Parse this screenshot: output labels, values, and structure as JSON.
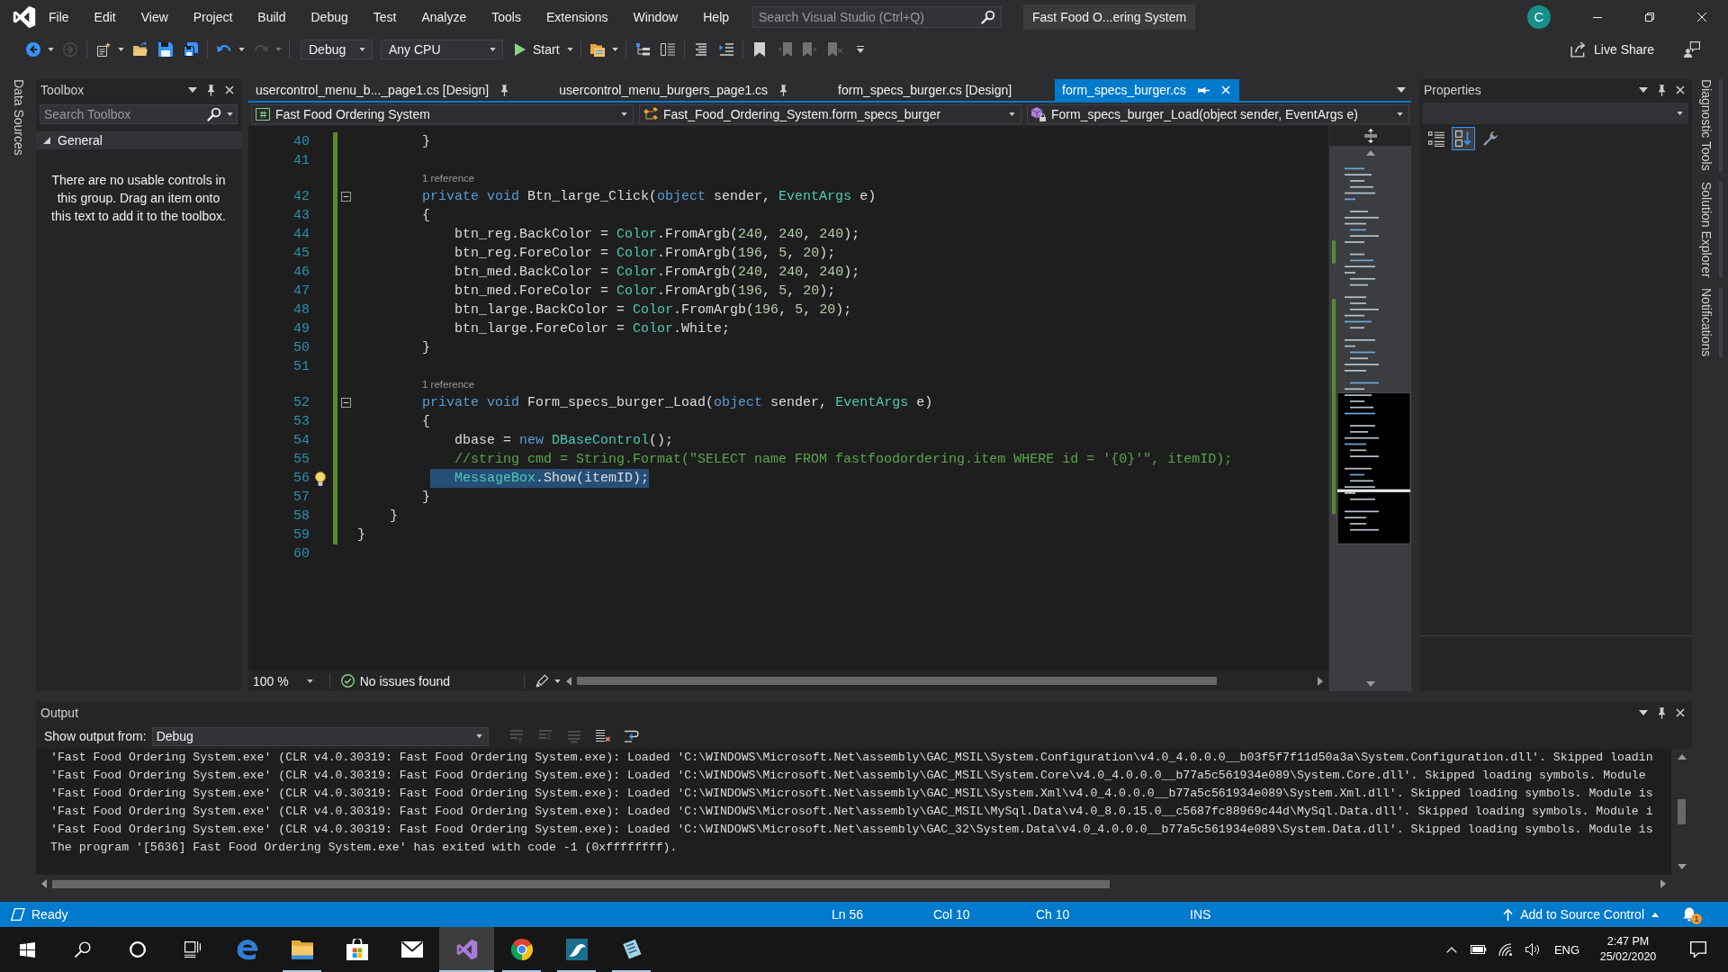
{
  "title_bar": {
    "menu": [
      "File",
      "Edit",
      "View",
      "Project",
      "Build",
      "Debug",
      "Test",
      "Analyze",
      "Tools",
      "Extensions",
      "Window",
      "Help"
    ],
    "search": {
      "placeholder": "Search Visual Studio (Ctrl+Q)"
    },
    "solution": "Fast Food O...ering System",
    "account": "C"
  },
  "toolbar": {
    "items": [
      {
        "kind": "back",
        "disabled": false
      },
      {
        "kind": "caret",
        "disabled": false
      },
      {
        "kind": "forward",
        "disabled": true
      },
      {
        "kind": "separator"
      },
      {
        "kind": "new-project",
        "disabled": false
      },
      {
        "kind": "caret",
        "disabled": false
      },
      {
        "kind": "open",
        "disabled": false
      },
      {
        "kind": "save",
        "disabled": false
      },
      {
        "kind": "save-all",
        "disabled": false
      },
      {
        "kind": "separator"
      },
      {
        "kind": "undo",
        "disabled": false
      },
      {
        "kind": "caret",
        "disabled": false
      },
      {
        "kind": "redo",
        "disabled": true
      },
      {
        "kind": "caret",
        "disabled": true
      },
      {
        "kind": "separator"
      },
      {
        "kind": "combo",
        "value": "Debug"
      },
      {
        "kind": "combo",
        "value": "Any CPU"
      },
      {
        "kind": "start",
        "label": "Start"
      },
      {
        "kind": "separator"
      },
      {
        "kind": "find",
        "disabled": false
      },
      {
        "kind": "caret",
        "disabled": false
      },
      {
        "kind": "separator"
      },
      {
        "kind": "tree",
        "disabled": false
      },
      {
        "kind": "columns",
        "disabled": false
      },
      {
        "kind": "separator"
      },
      {
        "kind": "align",
        "disabled": false
      },
      {
        "kind": "indent",
        "disabled": false
      },
      {
        "kind": "separator"
      },
      {
        "kind": "bookmark",
        "disabled": false
      },
      {
        "kind": "bookmark-prev",
        "disabled": true
      },
      {
        "kind": "bookmark-next",
        "disabled": true
      },
      {
        "kind": "bookmark-clear",
        "disabled": true
      },
      {
        "kind": "more",
        "disabled": false
      }
    ],
    "live_share": "Live Share"
  },
  "left_tabs": [
    "Data Sources"
  ],
  "toolbox": {
    "title": "Toolbox",
    "search": {
      "placeholder": "Search Toolbox"
    },
    "group": {
      "label": "General",
      "expanded": true
    },
    "message": "There are no usable controls in this group. Drag an item onto this text to add it to the toolbox."
  },
  "editor": {
    "tabs": [
      {
        "label": "usercontrol_menu_b..._page1.cs [Design]",
        "selected": false,
        "pinned": true
      },
      {
        "label": "usercontrol_menu_burgers_page1.cs",
        "selected": false,
        "pinned": true
      },
      {
        "label": "form_specs_burger.cs [Design]",
        "selected": false,
        "pinned": false
      },
      {
        "label": "form_specs_burger.cs",
        "selected": true,
        "pinned": false
      }
    ],
    "nav": {
      "project": "Fast Food Ordering System",
      "type": "Fast_Food_Ordering_System.form_specs_burger",
      "member": "Form_specs_burger_Load(object sender, EventArgs e)"
    },
    "lines": [
      {
        "kind": "code",
        "number": "40",
        "tokens": [
          {
            "kind": "plain",
            "text": "        }"
          }
        ],
        "changed": true,
        "selected": false,
        "fold": false,
        "bulb": false
      },
      {
        "kind": "code",
        "number": "41",
        "changed": true,
        "selected": false,
        "fold": false,
        "bulb": false
      },
      {
        "kind": "codelens",
        "text": "1 reference",
        "changed": true
      },
      {
        "kind": "code",
        "number": "42",
        "tokens": [
          {
            "kind": "keyword",
            "text": "        private void"
          },
          {
            "kind": "plain",
            "text": " Btn_large_Click("
          },
          {
            "kind": "keyword",
            "text": "object"
          },
          {
            "kind": "plain",
            "text": " sender, "
          },
          {
            "kind": "type",
            "text": "EventArgs"
          },
          {
            "kind": "plain",
            "text": " e)"
          }
        ],
        "changed": true,
        "selected": false,
        "fold": true,
        "bulb": false
      },
      {
        "kind": "code",
        "number": "43",
        "tokens": [
          {
            "kind": "plain",
            "text": "        {"
          }
        ],
        "changed": true,
        "selected": false,
        "fold": false,
        "bulb": false
      },
      {
        "kind": "code",
        "number": "44",
        "tokens": [
          {
            "kind": "plain",
            "text": "            btn_reg.BackColor = "
          },
          {
            "kind": "type",
            "text": "Color"
          },
          {
            "kind": "plain",
            "text": ".FromArgb("
          },
          {
            "kind": "number",
            "text": "240"
          },
          {
            "kind": "plain",
            "text": ", "
          },
          {
            "kind": "number",
            "text": "240"
          },
          {
            "kind": "plain",
            "text": ", "
          },
          {
            "kind": "number",
            "text": "240"
          },
          {
            "kind": "plain",
            "text": ");"
          }
        ],
        "changed": true,
        "selected": false,
        "fold": false,
        "bulb": false
      },
      {
        "kind": "code",
        "number": "45",
        "tokens": [
          {
            "kind": "plain",
            "text": "            btn_reg.ForeColor = "
          },
          {
            "kind": "type",
            "text": "Color"
          },
          {
            "kind": "plain",
            "text": ".FromArgb("
          },
          {
            "kind": "number",
            "text": "196"
          },
          {
            "kind": "plain",
            "text": ", "
          },
          {
            "kind": "number",
            "text": "5"
          },
          {
            "kind": "plain",
            "text": ", "
          },
          {
            "kind": "number",
            "text": "20"
          },
          {
            "kind": "plain",
            "text": ");"
          }
        ],
        "changed": true,
        "selected": false,
        "fold": false,
        "bulb": false
      },
      {
        "kind": "code",
        "number": "46",
        "tokens": [
          {
            "kind": "plain",
            "text": "            btn_med.BackColor = "
          },
          {
            "kind": "type",
            "text": "Color"
          },
          {
            "kind": "plain",
            "text": ".FromArgb("
          },
          {
            "kind": "number",
            "text": "240"
          },
          {
            "kind": "plain",
            "text": ", "
          },
          {
            "kind": "number",
            "text": "240"
          },
          {
            "kind": "plain",
            "text": ", "
          },
          {
            "kind": "number",
            "text": "240"
          },
          {
            "kind": "plain",
            "text": ");"
          }
        ],
        "changed": true,
        "selected": false,
        "fold": false,
        "bulb": false
      },
      {
        "kind": "code",
        "number": "47",
        "tokens": [
          {
            "kind": "plain",
            "text": "            btn_med.ForeColor = "
          },
          {
            "kind": "type",
            "text": "Color"
          },
          {
            "kind": "plain",
            "text": ".FromArgb("
          },
          {
            "kind": "number",
            "text": "196"
          },
          {
            "kind": "plain",
            "text": ", "
          },
          {
            "kind": "number",
            "text": "5"
          },
          {
            "kind": "plain",
            "text": ", "
          },
          {
            "kind": "number",
            "text": "20"
          },
          {
            "kind": "plain",
            "text": ");"
          }
        ],
        "changed": true,
        "selected": false,
        "fold": false,
        "bulb": false
      },
      {
        "kind": "code",
        "number": "48",
        "tokens": [
          {
            "kind": "plain",
            "text": "            btn_large.BackColor = "
          },
          {
            "kind": "type",
            "text": "Color"
          },
          {
            "kind": "plain",
            "text": ".FromArgb("
          },
          {
            "kind": "number",
            "text": "196"
          },
          {
            "kind": "plain",
            "text": ", "
          },
          {
            "kind": "number",
            "text": "5"
          },
          {
            "kind": "plain",
            "text": ", "
          },
          {
            "kind": "number",
            "text": "20"
          },
          {
            "kind": "plain",
            "text": ");"
          }
        ],
        "changed": true,
        "selected": false,
        "fold": false,
        "bulb": false
      },
      {
        "kind": "code",
        "number": "49",
        "tokens": [
          {
            "kind": "plain",
            "text": "            btn_large.ForeColor = "
          },
          {
            "kind": "type",
            "text": "Color"
          },
          {
            "kind": "plain",
            "text": ".White;"
          }
        ],
        "changed": true,
        "selected": false,
        "fold": false,
        "bulb": false
      },
      {
        "kind": "code",
        "number": "50",
        "tokens": [
          {
            "kind": "plain",
            "text": "        }"
          }
        ],
        "changed": true,
        "selected": false,
        "fold": false,
        "bulb": false
      },
      {
        "kind": "code",
        "number": "51",
        "changed": true,
        "selected": false,
        "fold": false,
        "bulb": false
      },
      {
        "kind": "codelens",
        "text": "1 reference",
        "changed": true
      },
      {
        "kind": "code",
        "number": "52",
        "tokens": [
          {
            "kind": "keyword",
            "text": "        private void"
          },
          {
            "kind": "plain",
            "text": " Form_specs_burger_Load("
          },
          {
            "kind": "keyword",
            "text": "object"
          },
          {
            "kind": "plain",
            "text": " sender, "
          },
          {
            "kind": "type",
            "text": "EventArgs"
          },
          {
            "kind": "plain",
            "text": " e)"
          }
        ],
        "changed": true,
        "selected": false,
        "fold": true,
        "bulb": false
      },
      {
        "kind": "code",
        "number": "53",
        "tokens": [
          {
            "kind": "plain",
            "text": "        {"
          }
        ],
        "changed": true,
        "selected": false,
        "fold": false,
        "bulb": false
      },
      {
        "kind": "code",
        "number": "54",
        "tokens": [
          {
            "kind": "plain",
            "text": "            dbase = "
          },
          {
            "kind": "keyword",
            "text": "new"
          },
          {
            "kind": "type",
            "text": " DBaseControl"
          },
          {
            "kind": "plain",
            "text": "();"
          }
        ],
        "changed": true,
        "selected": false,
        "fold": false,
        "bulb": false
      },
      {
        "kind": "code",
        "number": "55",
        "tokens": [
          {
            "kind": "comment",
            "text": "            //string cmd = String.Format(\"SELECT name FROM fastfoodordering.item WHERE id = '{0}'\", itemID);"
          }
        ],
        "changed": true,
        "selected": false,
        "fold": false,
        "bulb": false
      },
      {
        "kind": "code",
        "number": "56",
        "tokens": [
          {
            "kind": "type",
            "text": "            MessageBox"
          },
          {
            "kind": "plain",
            "text": ".Show(itemID);"
          }
        ],
        "changed": true,
        "selected": true,
        "fold": false,
        "bulb": true
      },
      {
        "kind": "code",
        "number": "57",
        "tokens": [
          {
            "kind": "plain",
            "text": "        }"
          }
        ],
        "changed": true,
        "selected": false,
        "fold": false,
        "bulb": false
      },
      {
        "kind": "code",
        "number": "58",
        "tokens": [
          {
            "kind": "plain",
            "text": "    }"
          }
        ],
        "changed": true,
        "selected": false,
        "fold": false,
        "bulb": false
      },
      {
        "kind": "code",
        "number": "59",
        "tokens": [
          {
            "kind": "plain",
            "text": "}"
          }
        ],
        "changed": true,
        "selected": false,
        "fold": false,
        "bulb": false
      },
      {
        "kind": "code",
        "number": "60",
        "changed": false,
        "selected": false,
        "fold": false,
        "bulb": false
      }
    ],
    "zoom": "100 %",
    "issues": "No issues found"
  },
  "properties": {
    "title": "Properties",
    "view_buttons": [
      {
        "kind": "categorized",
        "selected": false
      },
      {
        "kind": "alphabetical",
        "selected": true
      },
      {
        "kind": "pages",
        "selected": false
      }
    ]
  },
  "right_tabs": [
    "Diagnostic Tools",
    "Solution Explorer",
    "Notifications"
  ],
  "output": {
    "title": "Output",
    "source_label": "Show output from:",
    "source": "Debug",
    "tools": [
      {
        "kind": "prev",
        "disabled": true
      },
      {
        "kind": "next",
        "disabled": true
      },
      {
        "kind": "goto",
        "disabled": true
      },
      {
        "kind": "clear",
        "disabled": false
      },
      {
        "kind": "wrap",
        "disabled": false
      }
    ],
    "lines": [
      "'Fast Food Ordering System.exe' (CLR v4.0.30319: Fast Food Ordering System.exe): Loaded 'C:\\WINDOWS\\Microsoft.Net\\assembly\\GAC_MSIL\\System.Configuration\\v4.0_4.0.0.0__b03f5f7f11d50a3a\\System.Configuration.dll'. Skipped loadin",
      "'Fast Food Ordering System.exe' (CLR v4.0.30319: Fast Food Ordering System.exe): Loaded 'C:\\WINDOWS\\Microsoft.Net\\assembly\\GAC_MSIL\\System.Core\\v4.0_4.0.0.0__b77a5c561934e089\\System.Core.dll'. Skipped loading symbols. Module",
      "'Fast Food Ordering System.exe' (CLR v4.0.30319: Fast Food Ordering System.exe): Loaded 'C:\\WINDOWS\\Microsoft.Net\\assembly\\GAC_MSIL\\System.Xml\\v4.0_4.0.0.0__b77a5c561934e089\\System.Xml.dll'. Skipped loading symbols. Module is",
      "'Fast Food Ordering System.exe' (CLR v4.0.30319: Fast Food Ordering System.exe): Loaded 'C:\\WINDOWS\\Microsoft.Net\\assembly\\GAC_MSIL\\MySql.Data\\v4.0_8.0.15.0__c5687fc88969c44d\\MySql.Data.dll'. Skipped loading symbols. Module i",
      "'Fast Food Ordering System.exe' (CLR v4.0.30319: Fast Food Ordering System.exe): Loaded 'C:\\WINDOWS\\Microsoft.Net\\assembly\\GAC_32\\System.Data\\v4.0_4.0.0.0__b77a5c561934e089\\System.Data.dll'. Skipped loading symbols. Module is",
      "The program '[5636] Fast Food Ordering System.exe' has exited with code -1 (0xffffffff)."
    ]
  },
  "status_bar": {
    "state": "Ready",
    "line": "Ln 56",
    "column": "Col 10",
    "char": "Ch 10",
    "mode": "INS",
    "source_control": "Add to Source Control",
    "notifications": "1"
  },
  "taskbar": {
    "buttons": [
      {
        "kind": "start",
        "selected": false,
        "running": false
      },
      {
        "kind": "search",
        "selected": false,
        "running": false
      },
      {
        "kind": "cortana",
        "selected": false,
        "running": false
      },
      {
        "kind": "task-view",
        "selected": false,
        "running": false
      },
      {
        "kind": "browser",
        "selected": false,
        "running": false
      },
      {
        "kind": "files",
        "selected": false,
        "running": true
      },
      {
        "kind": "store",
        "selected": false,
        "running": false
      },
      {
        "kind": "mail",
        "selected": false,
        "running": false
      },
      {
        "kind": "ide",
        "selected": true,
        "running": true
      },
      {
        "kind": "chrome",
        "selected": false,
        "running": true
      },
      {
        "kind": "database",
        "selected": false,
        "running": true
      },
      {
        "kind": "notes",
        "selected": false,
        "running": true
      }
    ],
    "language": "ENG",
    "time": "2:47 PM",
    "date": "25/02/2020"
  }
}
